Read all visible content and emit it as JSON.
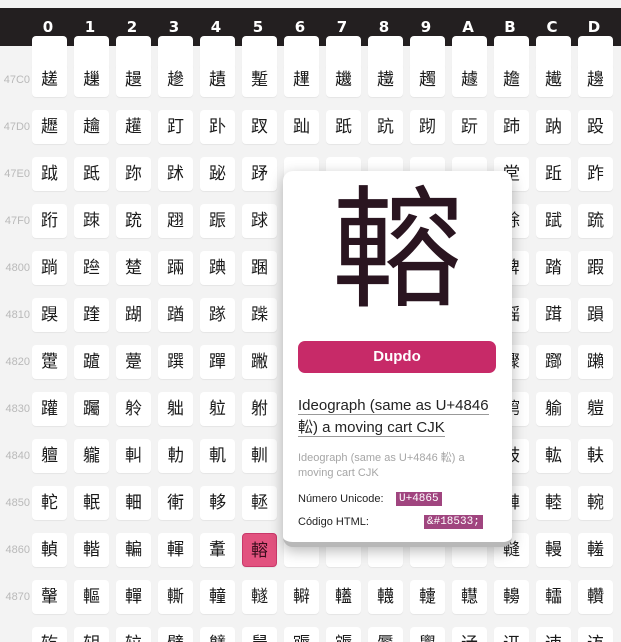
{
  "header": {
    "columns": [
      "0",
      "1",
      "2",
      "3",
      "4",
      "5",
      "6",
      "7",
      "8",
      "9",
      "A",
      "B",
      "C",
      "D"
    ]
  },
  "rows": [
    {
      "label": "",
      "chars": [
        "",
        "",
        "",
        "",
        "",
        "",
        "",
        "",
        "",
        "",
        "",
        "",
        "",
        ""
      ]
    },
    {
      "label": "47C0",
      "chars": [
        "䟀",
        "䟁",
        "䟂",
        "䟃",
        "䟄",
        "䟅",
        "䟆",
        "䟇",
        "䟈",
        "䟉",
        "䟊",
        "䟋",
        "䟌",
        "䟍"
      ]
    },
    {
      "label": "47D0",
      "chars": [
        "䟐",
        "䟑",
        "䟒",
        "䟓",
        "䟔",
        "䟕",
        "䟖",
        "䟗",
        "䟘",
        "䟙",
        "䟚",
        "䟛",
        "䟜",
        "䟝"
      ]
    },
    {
      "label": "47E0",
      "chars": [
        "䟠",
        "䟡",
        "䟢",
        "䟣",
        "䟤",
        "䟥",
        "",
        "",
        "",
        "",
        "",
        "䟫",
        "䟬",
        "䟭"
      ]
    },
    {
      "label": "47F0",
      "chars": [
        "䟰",
        "䟱",
        "䟲",
        "䟳",
        "䟴",
        "䟵",
        "",
        "",
        "",
        "",
        "",
        "䟻",
        "䟼",
        "䟽"
      ]
    },
    {
      "label": "4800",
      "chars": [
        "䠀",
        "䠁",
        "䠂",
        "䠃",
        "䠄",
        "䠅",
        "",
        "",
        "",
        "",
        "",
        "䠋",
        "䠌",
        "䠍"
      ]
    },
    {
      "label": "4810",
      "chars": [
        "䠐",
        "䠑",
        "䠒",
        "䠓",
        "䠔",
        "䠕",
        "",
        "",
        "",
        "",
        "",
        "䠛",
        "䠜",
        "䠝"
      ]
    },
    {
      "label": "4820",
      "chars": [
        "䠠",
        "䠡",
        "䠢",
        "䠣",
        "䠤",
        "䠥",
        "",
        "",
        "",
        "",
        "",
        "䠫",
        "䠬",
        "䠭"
      ]
    },
    {
      "label": "4830",
      "chars": [
        "䠰",
        "䠱",
        "䠲",
        "䠳",
        "䠴",
        "䠵",
        "",
        "",
        "",
        "",
        "",
        "䠻",
        "䠼",
        "䠽"
      ]
    },
    {
      "label": "4840",
      "chars": [
        "䡀",
        "䡁",
        "䡂",
        "䡃",
        "䡄",
        "䡅",
        "",
        "",
        "",
        "",
        "",
        "䡋",
        "䡌",
        "䡍"
      ]
    },
    {
      "label": "4850",
      "chars": [
        "䡐",
        "䡑",
        "䡒",
        "䡓",
        "䡔",
        "䡕",
        "",
        "",
        "",
        "",
        "",
        "䡛",
        "䡜",
        "䡝"
      ]
    },
    {
      "label": "4860",
      "chars": [
        "䡠",
        "䡡",
        "䡢",
        "䡣",
        "䡤",
        "䡥",
        "",
        "",
        "",
        "",
        "",
        "䡫",
        "䡬",
        "䡭"
      ]
    },
    {
      "label": "4870",
      "chars": [
        "䡰",
        "䡱",
        "䡲",
        "䡳",
        "䡴",
        "䡵",
        "䡶",
        "䡷",
        "䡸",
        "䡹",
        "䡺",
        "䡻",
        "䡼",
        "䡽"
      ]
    },
    {
      "label": "",
      "chars": [
        "䢀",
        "䢁",
        "䢂",
        "䢃",
        "䢄",
        "䢅",
        "䢆",
        "䢇",
        "䢈",
        "䢉",
        "䢊",
        "䢋",
        "䢌",
        "䢍"
      ]
    }
  ],
  "popup": {
    "glyph": "䡥",
    "button_label": "Dupdo",
    "description": "Ideograph (same as U+4846 䡆) a moving cart CJK",
    "description_sub": "Ideograph (same as U+4846 䡆) a moving cart CJK",
    "unicode_label": "Número Unicode:",
    "unicode_value": "U+4865",
    "html_label": "Código HTML:",
    "html_value": "&#18533;"
  },
  "colors": {
    "accent": "#c72a68",
    "active_cell": "#e2527f",
    "header_bg": "#231f20",
    "code_bg": "#a0457f"
  }
}
